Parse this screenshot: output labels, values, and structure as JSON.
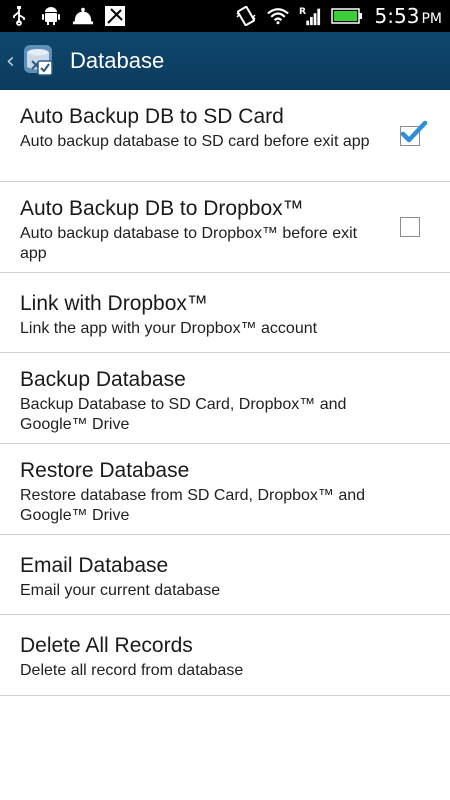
{
  "status_bar": {
    "time": "5:53",
    "ampm": "PM",
    "left_icons": [
      "usb-icon",
      "android-debug-icon",
      "notification-bell-icon",
      "app-notification-icon"
    ],
    "right_icons": [
      "vibrate-icon",
      "wifi-icon",
      "signal-icon",
      "battery-icon"
    ]
  },
  "action_bar": {
    "title": "Database",
    "app_icon": "database-icon",
    "back_icon": "chevron-left-icon"
  },
  "preferences": [
    {
      "title": "Auto Backup DB to SD Card",
      "summary": "Auto backup database to SD card before exit app",
      "checkbox": true,
      "checked": true
    },
    {
      "title": "Auto Backup DB to Dropbox™",
      "summary": "Auto backup database to Dropbox™ before exit app",
      "checkbox": true,
      "checked": false
    },
    {
      "title": "Link with Dropbox™",
      "summary": "Link the app with your Dropbox™ account"
    },
    {
      "title": "Backup Database",
      "summary": "Backup Database to SD Card, Dropbox™ and Google™ Drive"
    },
    {
      "title": "Restore Database",
      "summary": "Restore database from SD Card, Dropbox™ and Google™ Drive"
    },
    {
      "title": "Email Database",
      "summary": "Email your current database"
    },
    {
      "title": "Delete All Records",
      "summary": "Delete all record from database"
    }
  ],
  "colors": {
    "action_bar": "#0f476e",
    "checkmark": "#2e8ed6",
    "divider": "#cfcfcf"
  }
}
